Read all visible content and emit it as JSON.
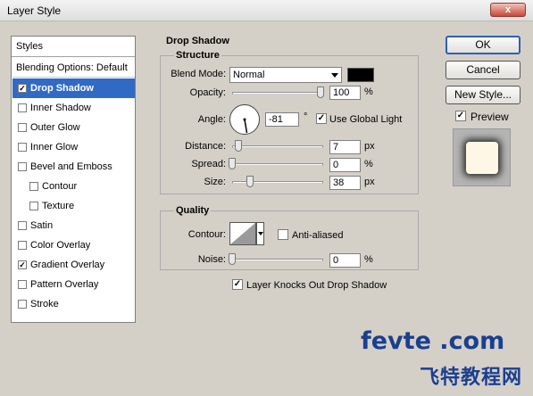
{
  "window": {
    "title": "Layer Style",
    "close_label": "x"
  },
  "styles_list": {
    "header": "Styles",
    "items": [
      {
        "label": "Blending Options: Default",
        "type": "plain",
        "checked": false
      },
      {
        "label": "Drop Shadow",
        "type": "check",
        "checked": true,
        "selected": true
      },
      {
        "label": "Inner Shadow",
        "type": "check",
        "checked": false
      },
      {
        "label": "Outer Glow",
        "type": "check",
        "checked": false
      },
      {
        "label": "Inner Glow",
        "type": "check",
        "checked": false
      },
      {
        "label": "Bevel and Emboss",
        "type": "check",
        "checked": false
      },
      {
        "label": "Contour",
        "type": "sub",
        "checked": false
      },
      {
        "label": "Texture",
        "type": "sub",
        "checked": false
      },
      {
        "label": "Satin",
        "type": "check",
        "checked": false
      },
      {
        "label": "Color Overlay",
        "type": "check",
        "checked": false
      },
      {
        "label": "Gradient Overlay",
        "type": "check",
        "checked": true
      },
      {
        "label": "Pattern Overlay",
        "type": "check",
        "checked": false
      },
      {
        "label": "Stroke",
        "type": "check",
        "checked": false
      }
    ]
  },
  "drop_shadow": {
    "title": "Drop Shadow",
    "structure": {
      "title": "Structure",
      "blend_mode_label": "Blend Mode:",
      "blend_mode_value": "Normal",
      "shadow_color": "#000000",
      "opacity_label": "Opacity:",
      "opacity_value": "100",
      "opacity_unit": "%",
      "angle_label": "Angle:",
      "angle_value": "-81",
      "angle_unit": "°",
      "use_global_light_label": "Use Global Light",
      "use_global_light_checked": true,
      "distance_label": "Distance:",
      "distance_value": "7",
      "distance_unit": "px",
      "spread_label": "Spread:",
      "spread_value": "0",
      "spread_unit": "%",
      "size_label": "Size:",
      "size_value": "38",
      "size_unit": "px"
    },
    "quality": {
      "title": "Quality",
      "contour_label": "Contour:",
      "anti_aliased_label": "Anti-aliased",
      "anti_aliased_checked": false,
      "noise_label": "Noise:",
      "noise_value": "0",
      "noise_unit": "%"
    },
    "layer_knocks_out_label": "Layer Knocks Out Drop Shadow",
    "layer_knocks_out_checked": true
  },
  "buttons": {
    "ok": "OK",
    "reset": "Cancel",
    "new_style": "New Style..."
  },
  "preview": {
    "label": "Preview",
    "checked": true
  },
  "watermark": {
    "top": "fevte .com",
    "bottom": "飞特教程网"
  }
}
